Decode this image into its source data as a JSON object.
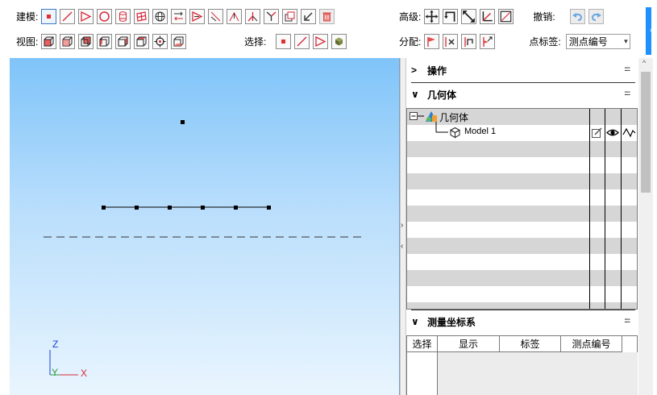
{
  "toolbar": {
    "modeling_label": "建模:",
    "view_label": "视图:",
    "select_label": "选择:",
    "advanced_label": "高级:",
    "undo_label": "撤销:",
    "assign_label": "分配:",
    "point_label_label": "点标签:",
    "point_label_value": "测点编号"
  },
  "panel": {
    "operations_title": "操作",
    "geometry_title": "几何体",
    "coord_title": "测量坐标系",
    "tree": {
      "root_label": "几何体",
      "child_label": "Model 1"
    },
    "coord_columns": [
      "选择",
      "显示",
      "标签",
      "测点编号"
    ]
  },
  "viewport": {
    "axis_z": "Z",
    "axis_y": "Y",
    "axis_x": "X"
  },
  "colors": {
    "accent": "#1e90ff",
    "delete_red": "#d9534f",
    "node_red": "#e03030",
    "line_red": "#d8283a"
  }
}
